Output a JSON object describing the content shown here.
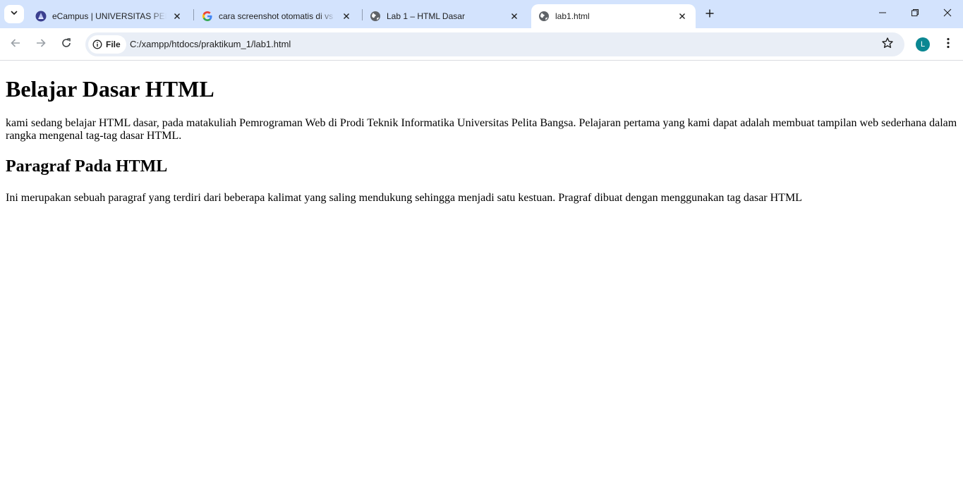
{
  "browser": {
    "tabs": [
      {
        "title": "eCampus | UNIVERSITAS PELITA BANGSA",
        "favicon": "campus-logo-icon",
        "active": false
      },
      {
        "title": "cara screenshot otomatis di vs code",
        "favicon": "google-g-icon",
        "active": false
      },
      {
        "title": "Lab 1 – HTML Dasar",
        "favicon": "globe-icon",
        "active": false
      },
      {
        "title": "lab1.html",
        "favicon": "globe-icon",
        "active": true
      }
    ],
    "omnibox": {
      "chip_label": "File",
      "url": "C:/xampp/htdocs/praktikum_1/lab1.html"
    },
    "profile_initial": "L",
    "colors": {
      "tabstrip": "#d3e3fd",
      "omnibox": "#e9eef6",
      "avatar": "#0b8792"
    }
  },
  "page": {
    "heading": "Belajar Dasar HTML",
    "intro": "kami sedang belajar HTML dasar, pada matakuliah Pemrograman Web di Prodi Teknik Informatika Universitas Pelita Bangsa. Pelajaran pertama yang kami dapat adalah membuat tampilan web sederhana dalam rangka mengenal tag-tag dasar HTML.",
    "subheading": "Paragraf Pada HTML",
    "paragraph": "Ini merupakan sebuah paragraf yang terdiri dari beberapa kalimat yang saling mendukung sehingga menjadi satu kestuan. Pragraf dibuat dengan menggunakan tag dasar HTML"
  }
}
